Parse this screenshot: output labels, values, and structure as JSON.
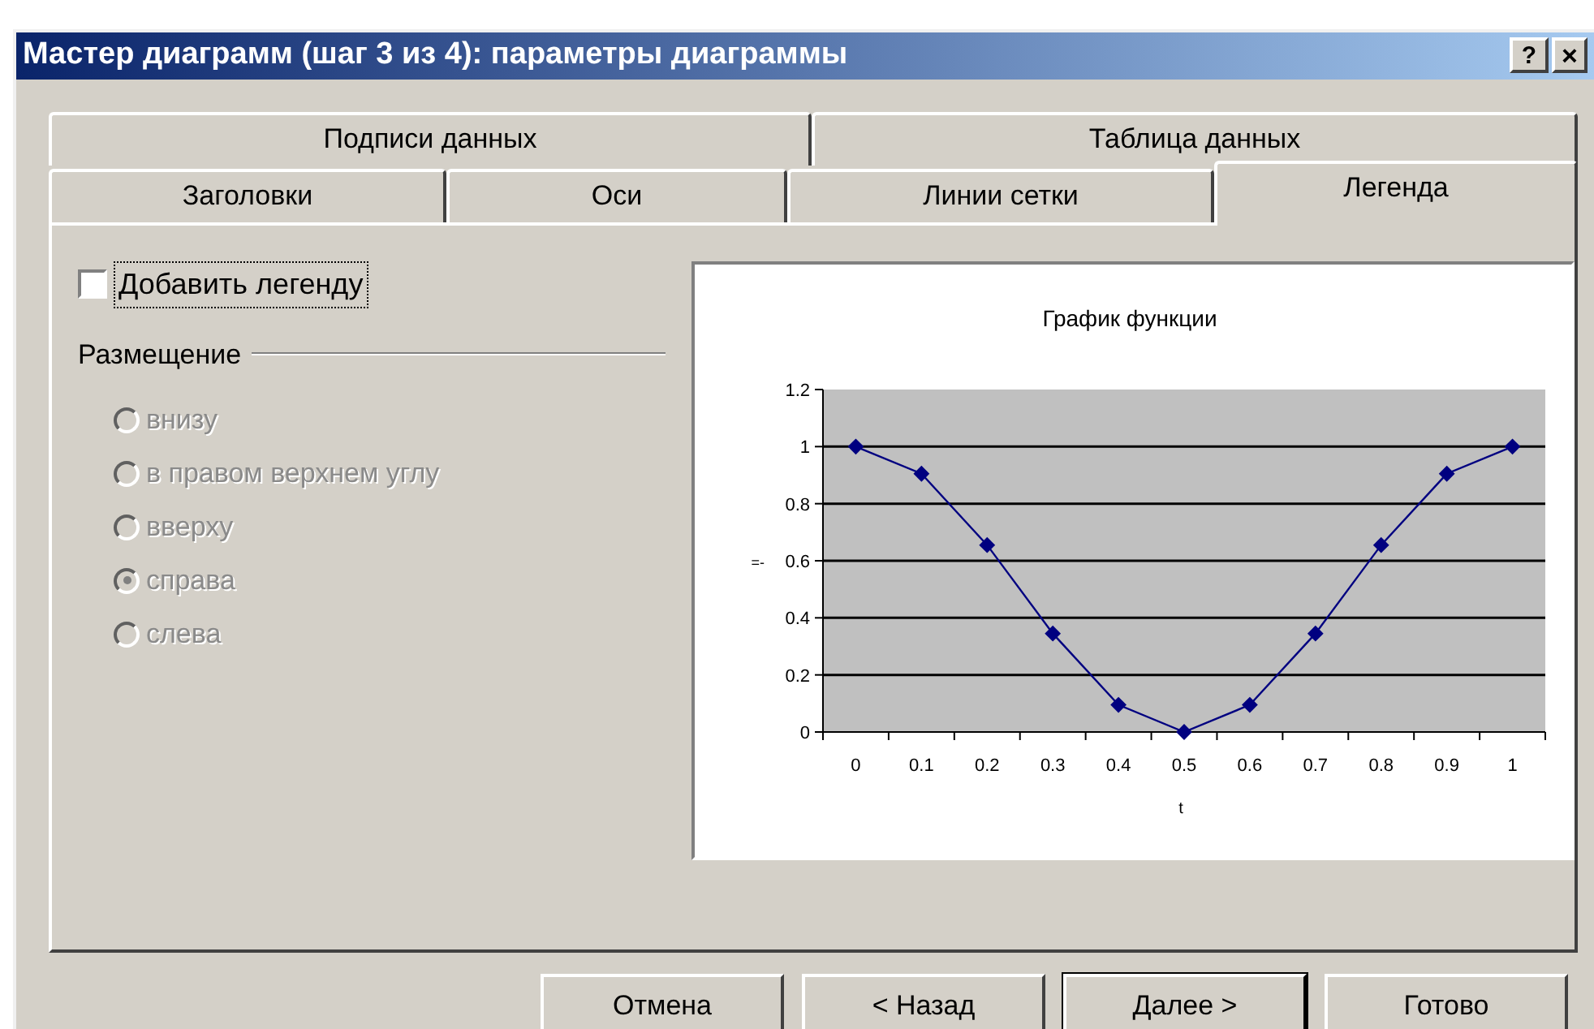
{
  "window": {
    "title": "Мастер диаграмм (шаг 3 из 4): параметры диаграммы",
    "help_button": "?",
    "close_button": "×"
  },
  "tabs": [
    [
      {
        "label": "Подписи данных",
        "selected": false
      },
      {
        "label": "Таблица данных",
        "selected": false
      }
    ],
    [
      {
        "label": "Заголовки",
        "selected": false
      },
      {
        "label": "Оси",
        "selected": false
      },
      {
        "label": "Линии сетки",
        "selected": false
      },
      {
        "label": "Легенда",
        "selected": true
      }
    ]
  ],
  "legend": {
    "label": "Добавить легенду",
    "checked": false
  },
  "placement": {
    "title": "Размещение",
    "disabled": true,
    "options": [
      {
        "label": "внизу",
        "selected": false
      },
      {
        "label": "в правом верхнем углу",
        "selected": false
      },
      {
        "label": "вверху",
        "selected": false
      },
      {
        "label": "справа",
        "selected": true
      },
      {
        "label": "слева",
        "selected": false
      }
    ]
  },
  "preview": {
    "chart_data": {
      "type": "line",
      "title": "График функции",
      "xlabel": "t",
      "ylabel": "=-",
      "categories": [
        "0",
        "0.1",
        "0.2",
        "0.3",
        "0.4",
        "0.5",
        "0.6",
        "0.7",
        "0.8",
        "0.9",
        "1"
      ],
      "ylim": [
        0,
        1.2
      ],
      "yticks": [
        0,
        0.2,
        0.4,
        0.6,
        0.8,
        1,
        1.2
      ],
      "grid": true,
      "series": [
        {
          "color": "#000080",
          "marker": "diamond",
          "values": [
            1,
            0.905,
            0.655,
            0.345,
            0.095,
            0,
            0.095,
            0.345,
            0.655,
            0.905,
            1
          ]
        }
      ]
    }
  },
  "buttons": [
    {
      "label": "Отмена",
      "default": false
    },
    {
      "label": "< Назад",
      "default": false
    },
    {
      "label": "Далее >",
      "default": true
    },
    {
      "label": "Готово",
      "default": false
    }
  ]
}
